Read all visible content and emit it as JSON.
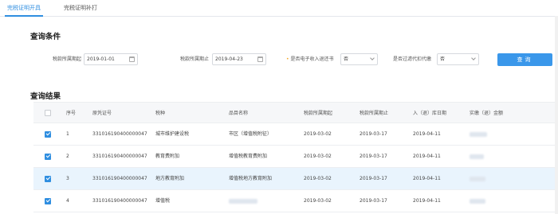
{
  "tabs": [
    {
      "label": "完税证明开具"
    },
    {
      "label": "完税证明补打"
    }
  ],
  "query": {
    "title": "查询条件",
    "start_label": "税款所属期起",
    "start_value": "2019-01-01",
    "end_label": "税款所属期止",
    "end_value": "2019-04-23",
    "einvoice_label": "是否电子收入退还书",
    "einvoice_value": "否",
    "agent_label": "是否过滤代扣代缴",
    "agent_value": "否",
    "button_label": "查询"
  },
  "results": {
    "title": "查询结果",
    "columns": [
      "序号",
      "原凭证号",
      "税种",
      "品目名称",
      "税款所属期起",
      "税款所属期止",
      "入（退）库日期",
      "实缴（退）金额"
    ],
    "rows": [
      {
        "no": "1",
        "voucher": "331016190400000047",
        "tax": "城市维护建设税",
        "item": "市区（增值税附征）",
        "start": "2019-03-02",
        "end": "2019-03-17",
        "date": "2019-04-11",
        "checked": true
      },
      {
        "no": "2",
        "voucher": "331016190400000047",
        "tax": "教育费附加",
        "item": "增值税教育费附加",
        "start": "2019-03-02",
        "end": "2019-03-17",
        "date": "2019-04-11",
        "checked": true
      },
      {
        "no": "3",
        "voucher": "331016190400000047",
        "tax": "地方教育附加",
        "item": "增值税地方教育附加",
        "start": "2019-03-02",
        "end": "2019-03-17",
        "date": "2019-04-11",
        "checked": true
      },
      {
        "no": "4",
        "voucher": "331016190400000047",
        "tax": "增值税",
        "item": "",
        "start": "2019-03-02",
        "end": "2019-03-17",
        "date": "2019-04-11",
        "checked": true
      }
    ]
  }
}
